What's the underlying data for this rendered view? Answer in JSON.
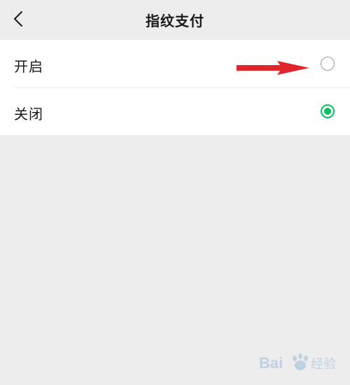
{
  "header": {
    "title": "指纹支付",
    "back_icon": "chevron-left-icon"
  },
  "options": [
    {
      "label": "开启",
      "selected": false
    },
    {
      "label": "关闭",
      "selected": true
    }
  ],
  "colors": {
    "accent": "#07c160",
    "annotation_arrow": "#e0252b",
    "background": "#ededed"
  },
  "watermark": {
    "text_latin": "Bai",
    "text_cn": "经验"
  }
}
